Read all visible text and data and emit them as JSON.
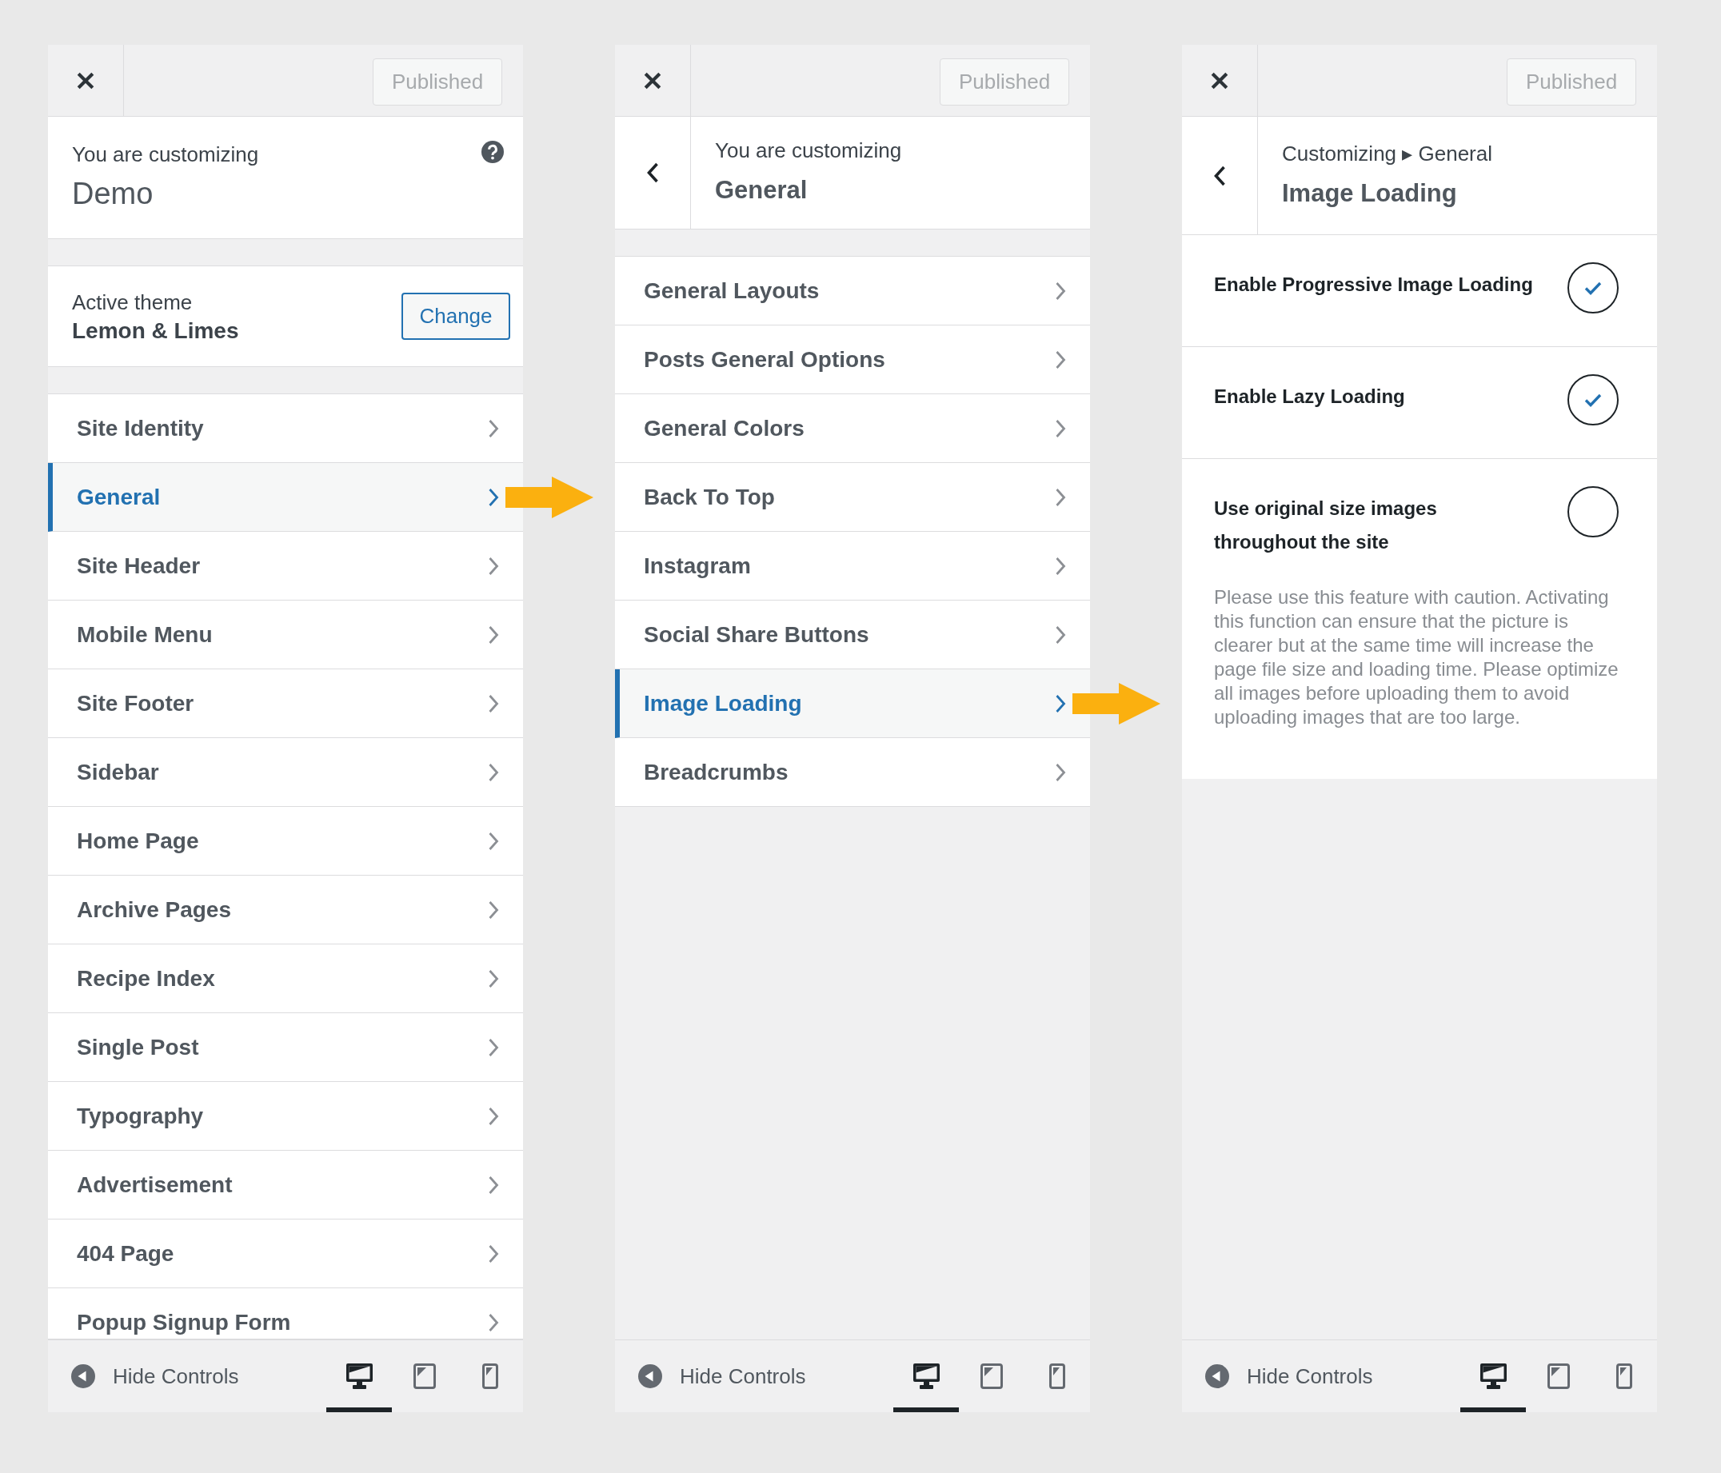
{
  "panels": [
    {
      "kind": "root",
      "publish_button": {
        "label": "Published",
        "disabled": true
      },
      "heading": {
        "caption": "You are customizing",
        "title": "Demo"
      },
      "theme": {
        "caption": "Active theme",
        "name": "Lemon & Limes",
        "button": "Change"
      },
      "items": [
        {
          "label": "Site Identity",
          "selected": false
        },
        {
          "label": "General",
          "selected": true
        },
        {
          "label": "Site Header",
          "selected": false
        },
        {
          "label": "Mobile Menu",
          "selected": false
        },
        {
          "label": "Site Footer",
          "selected": false
        },
        {
          "label": "Sidebar",
          "selected": false
        },
        {
          "label": "Home Page",
          "selected": false
        },
        {
          "label": "Archive Pages",
          "selected": false
        },
        {
          "label": "Recipe Index",
          "selected": false
        },
        {
          "label": "Single Post",
          "selected": false
        },
        {
          "label": "Typography",
          "selected": false
        },
        {
          "label": "Advertisement",
          "selected": false
        },
        {
          "label": "404 Page",
          "selected": false
        },
        {
          "label": "Popup Signup Form",
          "selected": false
        }
      ],
      "footer": {
        "label": "Hide Controls",
        "devices": [
          {
            "kind": "desktop",
            "selected": true
          },
          {
            "kind": "tablet",
            "selected": false
          },
          {
            "kind": "mobile",
            "selected": false
          }
        ]
      }
    },
    {
      "kind": "section",
      "publish_button": {
        "label": "Published",
        "disabled": true
      },
      "heading": {
        "caption": "You are customizing",
        "title": "General"
      },
      "items": [
        {
          "label": "General Layouts",
          "selected": false
        },
        {
          "label": "Posts General Options",
          "selected": false
        },
        {
          "label": "General Colors",
          "selected": false
        },
        {
          "label": "Back To Top",
          "selected": false
        },
        {
          "label": "Instagram",
          "selected": false
        },
        {
          "label": "Social Share Buttons",
          "selected": false
        },
        {
          "label": "Image Loading",
          "selected": true
        },
        {
          "label": "Breadcrumbs",
          "selected": false
        }
      ],
      "footer": {
        "label": "Hide Controls",
        "devices": [
          {
            "kind": "desktop",
            "selected": true
          },
          {
            "kind": "tablet",
            "selected": false
          },
          {
            "kind": "mobile",
            "selected": false
          }
        ]
      }
    },
    {
      "kind": "options",
      "publish_button": {
        "label": "Published",
        "disabled": true
      },
      "heading": {
        "caption": "Customizing ▸ General",
        "title": "Image Loading"
      },
      "options": [
        {
          "label": "Enable Progressive Image Loading",
          "checked": true
        },
        {
          "label": "Enable Lazy Loading",
          "checked": true
        },
        {
          "label": "Use original size images throughout the site",
          "checked": false,
          "description": "Please use this feature with caution. Activating this function can ensure that the picture is clearer but at the same time will increase the page file size and loading time. Please optimize all images before uploading them to avoid uploading images that are too large."
        }
      ],
      "footer": {
        "label": "Hide Controls",
        "devices": [
          {
            "kind": "desktop",
            "selected": true
          },
          {
            "kind": "tablet",
            "selected": false
          },
          {
            "kind": "mobile",
            "selected": false
          }
        ]
      }
    }
  ]
}
